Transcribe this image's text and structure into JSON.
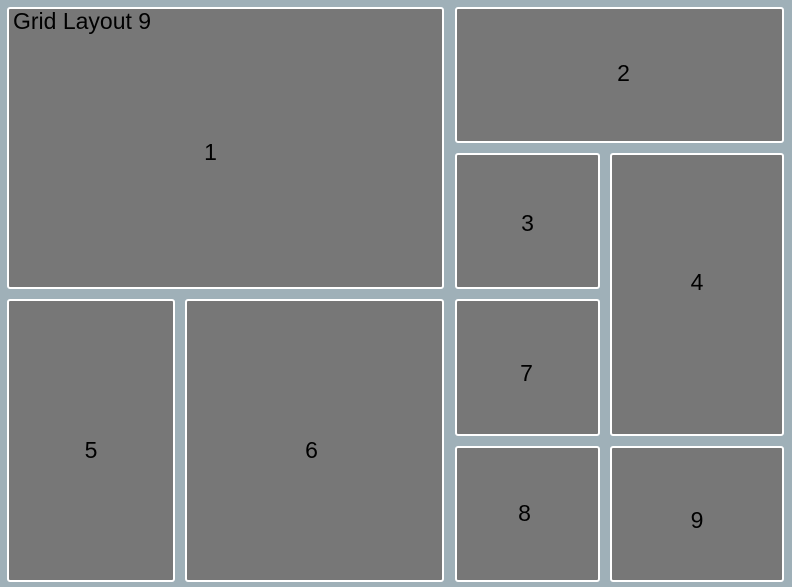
{
  "title": "Grid Layout 9",
  "cells": [
    {
      "label": "1"
    },
    {
      "label": "2"
    },
    {
      "label": "3"
    },
    {
      "label": "4"
    },
    {
      "label": "5"
    },
    {
      "label": "6"
    },
    {
      "label": "7"
    },
    {
      "label": "8"
    },
    {
      "label": "9"
    }
  ],
  "colors": {
    "background": "#9fb0b8",
    "cell": "#777777",
    "border": "#ffffff"
  }
}
